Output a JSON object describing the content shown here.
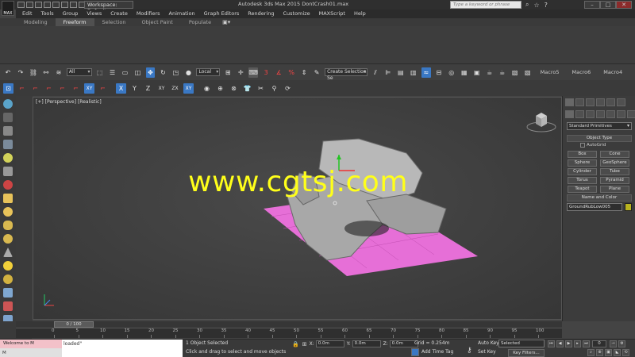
{
  "titlebar": {
    "workspace": "Workspace: Default",
    "window_title": "Autodesk 3ds Max 2015    DontCrash01.max",
    "search_placeholder": "Type a keyword or phrase",
    "logo": "MAX"
  },
  "menu": [
    "Edit",
    "Tools",
    "Group",
    "Views",
    "Create",
    "Modifiers",
    "Animation",
    "Graph Editors",
    "Rendering",
    "Customize",
    "MAXScript",
    "Help"
  ],
  "ribbon_tabs": [
    "Modeling",
    "Freeform",
    "Selection",
    "Object Paint",
    "Populate"
  ],
  "ribbon_active": "Freeform",
  "toolbar": {
    "selection_filter": "All",
    "ref_coord": "Local",
    "named_selection": "Create Selection Se",
    "macros": [
      "Macro5",
      "Macro6",
      "Macro4"
    ]
  },
  "axis_constraints": [
    "X",
    "Y",
    "Z",
    "XY",
    "ZX",
    "XY"
  ],
  "viewport": {
    "label": "[+] [Perspective] [Realistic]",
    "watermark": "www.cgtsj.com"
  },
  "command_panel": {
    "category": "Standard Primitives",
    "object_type_title": "Object Type",
    "autogrid": "AutoGrid",
    "object_buttons": [
      "Box",
      "Cone",
      "Sphere",
      "GeoSphere",
      "Cylinder",
      "Tube",
      "Torus",
      "Pyramid",
      "Teapot",
      "Plane"
    ],
    "name_color_title": "Name and Color",
    "object_name": "GroundRubLow005"
  },
  "timeline": {
    "slider": "0 / 100",
    "ticks": [
      "0",
      "5",
      "10",
      "15",
      "20",
      "25",
      "30",
      "35",
      "40",
      "45",
      "50",
      "55",
      "60",
      "65",
      "70",
      "75",
      "80",
      "85",
      "90",
      "95",
      "100"
    ]
  },
  "status": {
    "maxscript_label": "Welcome to M",
    "listener_label": "M",
    "maxscript_output": "loaded\"",
    "selection": "1 Object Selected",
    "prompt": "Click and drag to select and move objects",
    "x_label": "X:",
    "x": "0.0m",
    "y_label": "Y:",
    "y": "0.0m",
    "z_label": "Z:",
    "z": "0.0m",
    "grid": "Grid = 0.254m",
    "add_time_tag": "Add Time Tag",
    "auto_key": "Auto Key",
    "set_key": "Set Key",
    "selected_mode": "Selected",
    "key_filters": "Key Filters...",
    "frame": "0"
  },
  "colors": {
    "accent_blue": "#3a78c4",
    "watermark": "#ffff1a",
    "plane_pink": "#e66fd7",
    "swatch": "#b8b31f"
  }
}
